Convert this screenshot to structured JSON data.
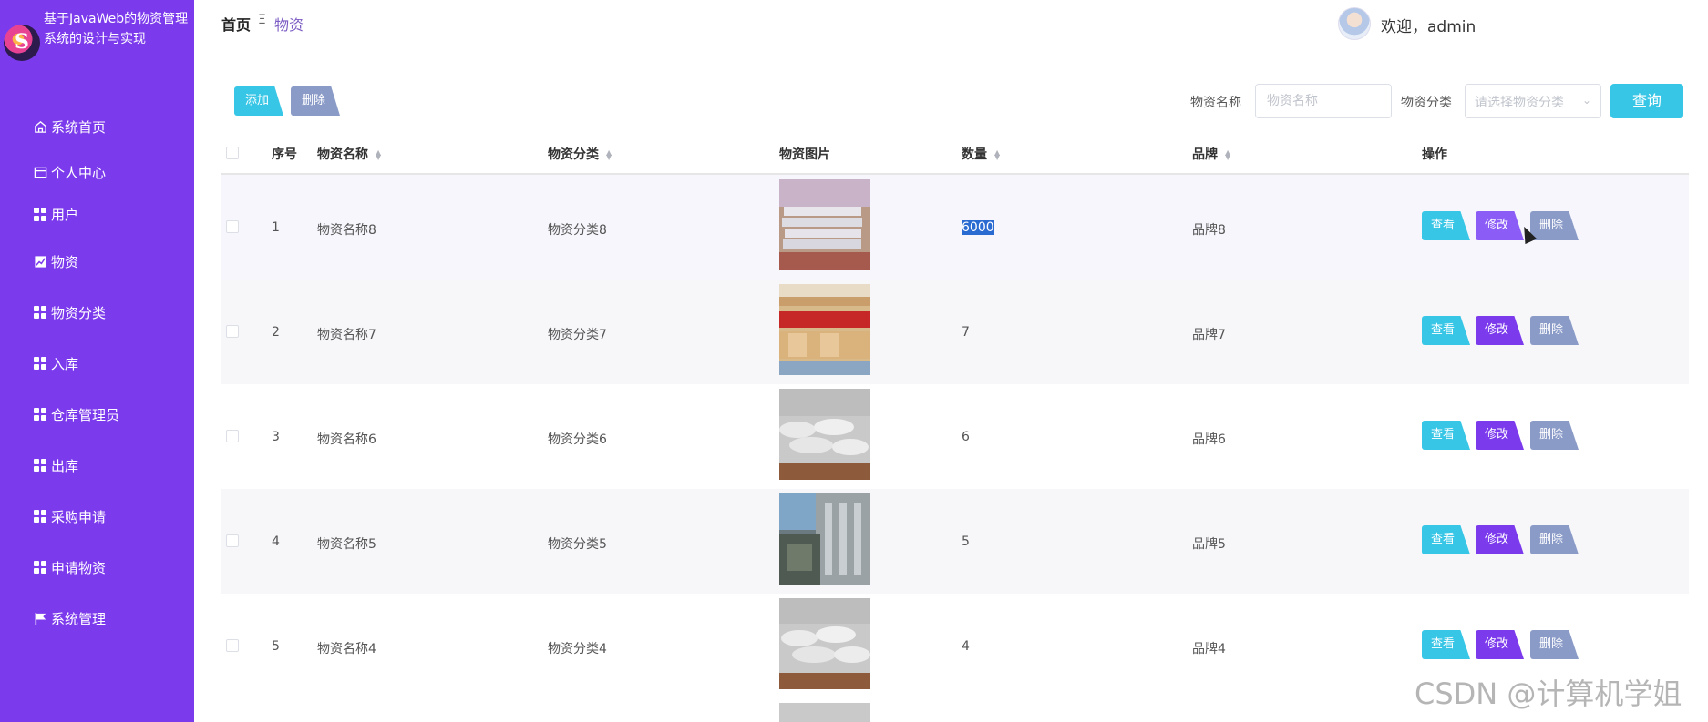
{
  "brand": {
    "title": "基于JavaWeb的物资管理系统的设计与实现"
  },
  "sidebar": {
    "items": [
      {
        "label": "系统首页",
        "icon": "home-icon"
      },
      {
        "label": "个人中心",
        "icon": "card-icon"
      },
      {
        "label": "用户",
        "icon": "grid-icon"
      },
      {
        "label": "物资",
        "icon": "chart-icon"
      },
      {
        "label": "物资分类",
        "icon": "grid-icon"
      },
      {
        "label": "入库",
        "icon": "grid-icon"
      },
      {
        "label": "仓库管理员",
        "icon": "grid-icon"
      },
      {
        "label": "出库",
        "icon": "grid-icon"
      },
      {
        "label": "采购申请",
        "icon": "grid-icon"
      },
      {
        "label": "申请物资",
        "icon": "grid-icon"
      },
      {
        "label": "系统管理",
        "icon": "flag-icon"
      }
    ]
  },
  "header": {
    "breadcrumb_home": "首页",
    "breadcrumb_sep": "Ξ",
    "breadcrumb_current": "物资",
    "welcome": "欢迎，admin"
  },
  "toolbar": {
    "add_label": "添加",
    "delete_label": "删除",
    "name_label": "物资名称",
    "name_placeholder": "物资名称",
    "category_label": "物资分类",
    "category_placeholder": "请选择物资分类",
    "query_label": "查询"
  },
  "table": {
    "headers": [
      "序号",
      "物资名称",
      "物资分类",
      "物资图片",
      "数量",
      "品牌",
      "操作"
    ],
    "rows": [
      {
        "index": "1",
        "name": "物资名称8",
        "category": "物资分类8",
        "qty_first": "6",
        "qty_rest": "000",
        "brand": "品牌8"
      },
      {
        "index": "2",
        "name": "物资名称7",
        "category": "物资分类7",
        "qty_first": "7",
        "qty_rest": "",
        "brand": "品牌7"
      },
      {
        "index": "3",
        "name": "物资名称6",
        "category": "物资分类6",
        "qty_first": "6",
        "qty_rest": "",
        "brand": "品牌6"
      },
      {
        "index": "4",
        "name": "物资名称5",
        "category": "物资分类5",
        "qty_first": "5",
        "qty_rest": "",
        "brand": "品牌5"
      },
      {
        "index": "5",
        "name": "物资名称4",
        "category": "物资分类4",
        "qty_first": "4",
        "qty_rest": "",
        "brand": "品牌4"
      }
    ],
    "actions": {
      "view": "查看",
      "edit": "修改",
      "delete": "删除"
    }
  },
  "watermark": "CSDN @计算机学姐",
  "colors": {
    "sidebar": "#7c3aed",
    "primary": "#38c6e6",
    "secondary": "#8a9bc8"
  }
}
